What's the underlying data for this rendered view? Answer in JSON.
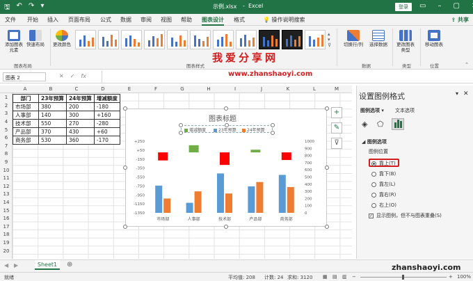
{
  "titlebar": {
    "filename": "示例.xlsx",
    "app": "Excel",
    "login": "登录"
  },
  "tabs": [
    "文件",
    "开始",
    "插入",
    "页面布局",
    "公式",
    "数据",
    "审阅",
    "视图",
    "帮助",
    "图表设计",
    "格式"
  ],
  "tell_me": "操作说明搜索",
  "share": "共享",
  "ribbon": {
    "add_element": "添加图表元素",
    "quick_layout": "快速布局",
    "change_color": "更改颜色",
    "group_layout": "图表布局",
    "group_style": "图表样式",
    "switch_rowcol": "切换行/列",
    "select_data": "选择数据",
    "group_data": "数据",
    "change_type": "更改图表类型",
    "group_type": "类型",
    "move_chart": "移动图表",
    "group_position": "位置"
  },
  "watermark": {
    "title": "我爱分享网",
    "url": "www.zhanshaoyi.com",
    "url2": "zhanshaoyi.com"
  },
  "namebox": "图表 2",
  "columns": [
    "A",
    "B",
    "C",
    "D",
    "E",
    "F",
    "G",
    "H",
    "I",
    "J",
    "K",
    "L",
    "M"
  ],
  "rows": [
    "1",
    "2",
    "3",
    "4",
    "5",
    "6",
    "7",
    "8",
    "9",
    "10",
    "11",
    "12",
    "13",
    "14",
    "15",
    "16",
    "17",
    "18",
    "19",
    "20"
  ],
  "table": {
    "headers": [
      "部门",
      "23年预算",
      "24年预算",
      "增减额度"
    ],
    "rows": [
      [
        "市场部",
        "380",
        "200",
        "-180"
      ],
      [
        "人事部",
        "140",
        "300",
        "+160"
      ],
      [
        "技术部",
        "550",
        "270",
        "-280"
      ],
      [
        "产品部",
        "370",
        "430",
        "+60"
      ],
      [
        "商务部",
        "530",
        "360",
        "-170"
      ]
    ]
  },
  "chart_data": {
    "type": "bar",
    "title": "图表标题",
    "legend_position": "top",
    "categories": [
      "市场部",
      "人事部",
      "技术部",
      "产品部",
      "商务部"
    ],
    "series": [
      {
        "name": "增减额度",
        "axis": "left",
        "values": [
          -180,
          160,
          -280,
          60,
          -170
        ]
      },
      {
        "name": "23年预算",
        "axis": "right",
        "values": [
          380,
          140,
          550,
          370,
          530
        ]
      },
      {
        "name": "24年预算",
        "axis": "right",
        "values": [
          200,
          300,
          270,
          430,
          360
        ]
      }
    ],
    "y_left_ticks": [
      "+250",
      "+50",
      "-150",
      "-350",
      "-550",
      "-750",
      "-950",
      "-1150",
      "-1350"
    ],
    "y_left_range": [
      -1350,
      250
    ],
    "y_right_ticks": [
      "1000",
      "900",
      "800",
      "700",
      "600",
      "500",
      "400",
      "300",
      "200",
      "100",
      "0"
    ],
    "y_right_range": [
      0,
      1000
    ],
    "colors": {
      "增减额度": "#70ad47",
      "23年预算": "#5b9bd5",
      "24年预算": "#ed7d31",
      "red": "#ff0000"
    }
  },
  "pane": {
    "title": "设置图例格式",
    "tab1": "图例选项",
    "tab2": "文本选项",
    "section": "图例选项",
    "position_label": "图例位置",
    "options": [
      "靠上(T)",
      "靠下(B)",
      "靠左(L)",
      "靠右(R)",
      "右上(O)"
    ],
    "checkbox": "显示图例，但不与图表重叠(S)"
  },
  "sheet": "Sheet1",
  "status": {
    "ready": "就绪",
    "avg": "平均值: 208",
    "count": "计数: 24",
    "sum": "求和: 3120",
    "zoom": "100%"
  }
}
